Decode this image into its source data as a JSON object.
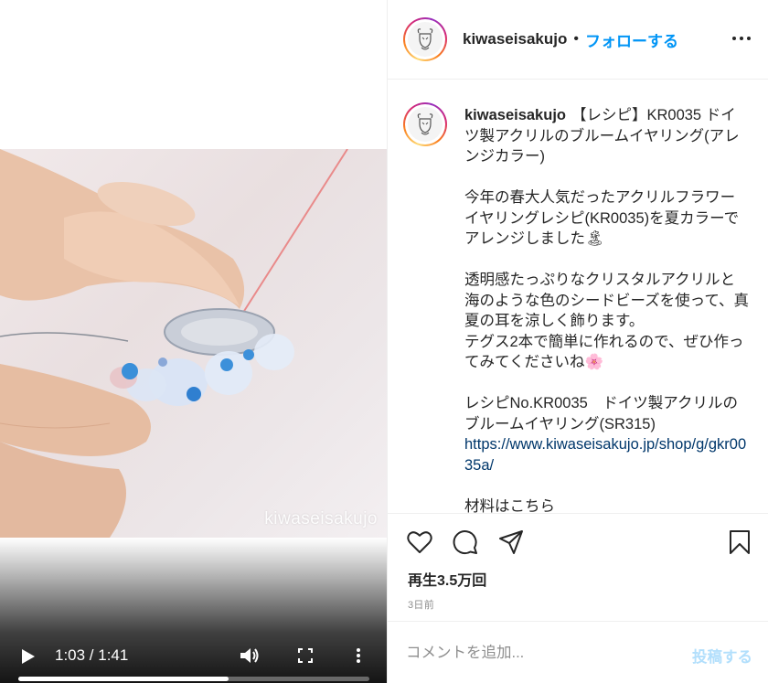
{
  "video": {
    "watermark": "kiwaseisakujo",
    "time_display": "1:03 / 1:41",
    "progress": 0.6
  },
  "header": {
    "username": "kiwaseisakujo",
    "separator": "•",
    "follow_label": "フォローする",
    "more_icon": "more-horizontal-icon"
  },
  "caption": {
    "username": "kiwaseisakujo",
    "title": "【レシピ】KR0035 ドイツ製アクリルのブルームイヤリング(アレンジカラー)",
    "para1": "今年の春大人気だったアクリルフラワーイヤリングレシピ(KR0035)を夏カラーでアレンジしました🏝",
    "para2_line1": "透明感たっぷりなクリスタルアクリルと海のような色のシードビーズを使って、真夏の耳を涼しく飾ります。",
    "para2_line2": "テグス2本で簡単に作れるので、ぜひ作ってみてくださいね🌸",
    "para3_line1": "レシピNo.KR0035　ドイツ製アクリルのブルームイヤリング(SR315)",
    "para3_link": "https://www.kiwaseisakujo.jp/shop/g/gkr0035a/",
    "para4": "材料はこちら"
  },
  "actions": {
    "views": "再生3.5万回",
    "timestamp": "3日前"
  },
  "comment": {
    "placeholder": "コメントを追加...",
    "post_label": "投稿する"
  },
  "colors": {
    "accent": "#0095f6",
    "post_disabled": "#b2dffc",
    "link": "#00376b"
  }
}
